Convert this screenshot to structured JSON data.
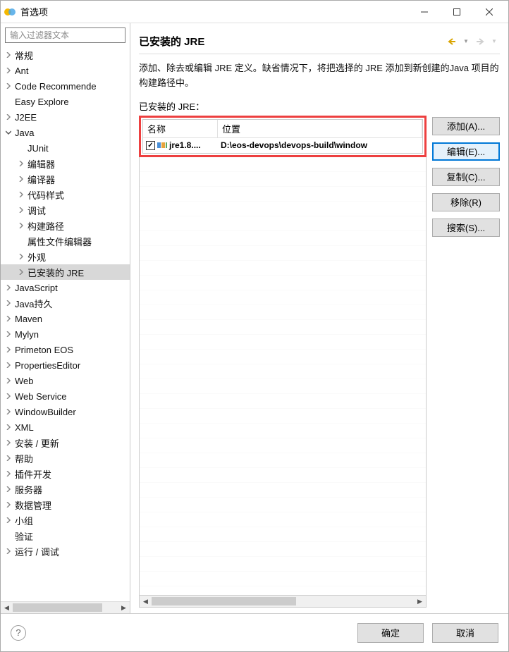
{
  "window": {
    "title": "首选项"
  },
  "sidebar": {
    "filter_placeholder": "输入过滤器文本",
    "items": [
      {
        "label": "常规",
        "level": 0,
        "arrow": "right"
      },
      {
        "label": "Ant",
        "level": 0,
        "arrow": "right"
      },
      {
        "label": "Code Recommende",
        "level": 0,
        "arrow": "right"
      },
      {
        "label": "Easy Explore",
        "level": 0,
        "arrow": "blank"
      },
      {
        "label": "J2EE",
        "level": 0,
        "arrow": "right"
      },
      {
        "label": "Java",
        "level": 0,
        "arrow": "down"
      },
      {
        "label": "JUnit",
        "level": 1,
        "arrow": "blank"
      },
      {
        "label": "编辑器",
        "level": 1,
        "arrow": "right"
      },
      {
        "label": "编译器",
        "level": 1,
        "arrow": "right"
      },
      {
        "label": "代码样式",
        "level": 1,
        "arrow": "right"
      },
      {
        "label": "调试",
        "level": 1,
        "arrow": "right"
      },
      {
        "label": "构建路径",
        "level": 1,
        "arrow": "right"
      },
      {
        "label": "属性文件编辑器",
        "level": 1,
        "arrow": "blank"
      },
      {
        "label": "外观",
        "level": 1,
        "arrow": "right"
      },
      {
        "label": "已安装的 JRE",
        "level": 1,
        "arrow": "right",
        "selected": true
      },
      {
        "label": "JavaScript",
        "level": 0,
        "arrow": "right"
      },
      {
        "label": "Java持久",
        "level": 0,
        "arrow": "right"
      },
      {
        "label": "Maven",
        "level": 0,
        "arrow": "right"
      },
      {
        "label": "Mylyn",
        "level": 0,
        "arrow": "right"
      },
      {
        "label": "Primeton EOS",
        "level": 0,
        "arrow": "right"
      },
      {
        "label": "PropertiesEditor",
        "level": 0,
        "arrow": "right"
      },
      {
        "label": "Web",
        "level": 0,
        "arrow": "right"
      },
      {
        "label": "Web Service",
        "level": 0,
        "arrow": "right"
      },
      {
        "label": "WindowBuilder",
        "level": 0,
        "arrow": "right"
      },
      {
        "label": "XML",
        "level": 0,
        "arrow": "right"
      },
      {
        "label": "安装 / 更新",
        "level": 0,
        "arrow": "right"
      },
      {
        "label": "帮助",
        "level": 0,
        "arrow": "right"
      },
      {
        "label": "插件开发",
        "level": 0,
        "arrow": "right"
      },
      {
        "label": "服务器",
        "level": 0,
        "arrow": "right"
      },
      {
        "label": "数据管理",
        "level": 0,
        "arrow": "right"
      },
      {
        "label": "小组",
        "level": 0,
        "arrow": "right"
      },
      {
        "label": "验证",
        "level": 0,
        "arrow": "blank"
      },
      {
        "label": "运行 / 调试",
        "level": 0,
        "arrow": "right"
      }
    ]
  },
  "main": {
    "title": "已安装的 JRE",
    "description": "添加、除去或编辑 JRE 定义。缺省情况下，将把选择的 JRE 添加到新创建的Java 项目的构建路径中。",
    "sub_label": "已安装的 JRE：",
    "columns": {
      "name": "名称",
      "location": "位置"
    },
    "rows": [
      {
        "checked": true,
        "name": "jre1.8....",
        "location": "D:\\eos-devops\\devops-build\\window"
      }
    ],
    "buttons": {
      "add": "添加(A)...",
      "edit": "编辑(E)...",
      "copy": "复制(C)...",
      "remove": "移除(R)",
      "search": "搜索(S)..."
    }
  },
  "footer": {
    "ok": "确定",
    "cancel": "取消"
  }
}
